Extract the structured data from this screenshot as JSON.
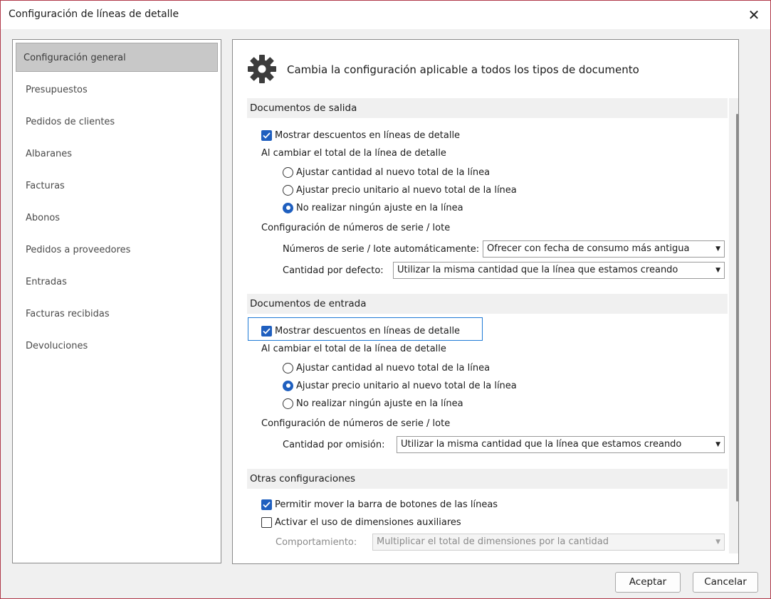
{
  "window": {
    "title": "Configuración de líneas de detalle"
  },
  "nav": {
    "items": [
      {
        "label": "Configuración general"
      },
      {
        "label": "Presupuestos"
      },
      {
        "label": "Pedidos de clientes"
      },
      {
        "label": "Albaranes"
      },
      {
        "label": "Facturas"
      },
      {
        "label": "Abonos"
      },
      {
        "label": "Pedidos a proveedores"
      },
      {
        "label": "Entradas"
      },
      {
        "label": "Facturas recibidas"
      },
      {
        "label": "Devoluciones"
      }
    ],
    "active": "Configuración general"
  },
  "header": {
    "text": "Cambia la configuración aplicable a todos los tipos de documento",
    "icon": "gear-icon"
  },
  "salida": {
    "title": "Documentos de salida",
    "mostrar_descuentos": {
      "label": "Mostrar descuentos en líneas de detalle",
      "checked": true
    },
    "al_cambiar": "Al cambiar el total de la línea de detalle",
    "radios": [
      {
        "label": "Ajustar cantidad al nuevo total de la línea",
        "checked": false
      },
      {
        "label": "Ajustar precio unitario al nuevo total de la línea",
        "checked": false
      },
      {
        "label": "No realizar ningún ajuste en la línea",
        "checked": true
      }
    ],
    "config_series": "Configuración de números de serie / lote",
    "auto_label": "Números de serie / lote automáticamente:",
    "auto_value": "Ofrecer con fecha de consumo más antigua",
    "cantidad_label": "Cantidad por defecto:",
    "cantidad_value": "Utilizar la misma cantidad que la línea que estamos creando"
  },
  "entrada": {
    "title": "Documentos de entrada",
    "mostrar_descuentos": {
      "label": "Mostrar descuentos en líneas de detalle",
      "checked": true
    },
    "al_cambiar": "Al cambiar el total de la línea de detalle",
    "radios": [
      {
        "label": "Ajustar cantidad al nuevo total de la línea",
        "checked": false
      },
      {
        "label": "Ajustar precio unitario al nuevo total de la línea",
        "checked": true
      },
      {
        "label": "No realizar ningún ajuste en la línea",
        "checked": false
      }
    ],
    "config_series": "Configuración de números de serie / lote",
    "cantidad_label": "Cantidad por omisión:",
    "cantidad_value": "Utilizar la misma cantidad que la línea que estamos creando"
  },
  "otras": {
    "title": "Otras configuraciones",
    "permitir": {
      "label": "Permitir mover la barra de botones de las líneas",
      "checked": true
    },
    "activar": {
      "label": "Activar el uso de dimensiones auxiliares",
      "checked": false
    },
    "comportamiento_label": "Comportamiento:",
    "comportamiento_value": "Multiplicar el total de dimensiones por la cantidad"
  },
  "buttons": {
    "ok": "Aceptar",
    "cancel": "Cancelar"
  },
  "colors": {
    "accent": "#1f5fbf",
    "focus": "#1f7ad6",
    "title_border": "#b03a4a"
  }
}
